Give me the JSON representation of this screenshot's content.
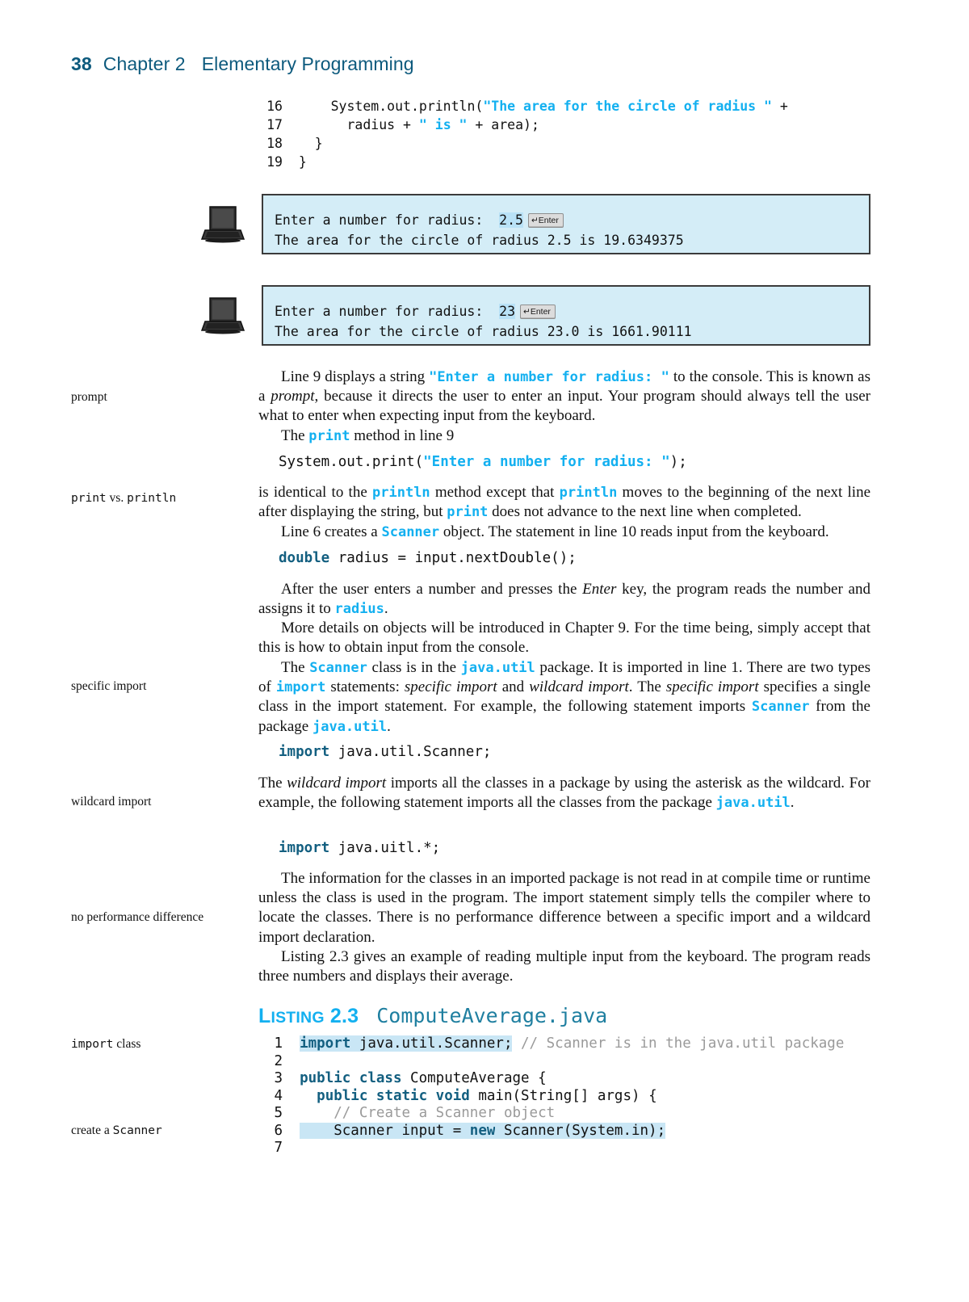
{
  "header": {
    "page_number": "38",
    "chapter": "Chapter 2",
    "title": "Elementary Programming",
    "accent_color": "#0d5a7d"
  },
  "top_code": {
    "lines": [
      {
        "num": "16",
        "segments": [
          {
            "text": "    System.out.println(",
            "style": "plain"
          },
          {
            "text": "\"The area for the circle of radius \"",
            "style": "string"
          },
          {
            "text": " +",
            "style": "plain"
          }
        ]
      },
      {
        "num": "17",
        "segments": [
          {
            "text": "      radius + ",
            "style": "plain"
          },
          {
            "text": "\" is \"",
            "style": "string"
          },
          {
            "text": " + area);",
            "style": "plain"
          }
        ]
      },
      {
        "num": "18",
        "segments": [
          {
            "text": "  }",
            "style": "plain"
          }
        ]
      },
      {
        "num": "19",
        "segments": [
          {
            "text": "}",
            "style": "plain"
          }
        ]
      }
    ]
  },
  "consoles": [
    {
      "icon": "laptop-icon",
      "prompt_label": "Enter a number for radius:  ",
      "input_value": "2.5",
      "enter_key_label": "Enter",
      "result_line": "The area for the circle of radius 2.5 is 19.6349375",
      "bg_color": "#d4edf7",
      "border_color": "#3b3b3b"
    },
    {
      "icon": "laptop-icon",
      "prompt_label": "Enter a number for radius:  ",
      "input_value": "23",
      "enter_key_label": "Enter",
      "result_line": "The area for the circle of radius 23.0 is 1661.90111",
      "bg_color": "#d4edf7",
      "border_color": "#3b3b3b"
    }
  ],
  "margin_notes": [
    {
      "id": "prompt",
      "text": "prompt"
    },
    {
      "id": "print-vs-println",
      "pre": "print",
      "mid": " vs. ",
      "post": "println"
    },
    {
      "id": "specific-import",
      "text": "specific import"
    },
    {
      "id": "wildcard-import",
      "text": "wildcard import"
    },
    {
      "id": "no-performance-difference",
      "text": "no performance difference"
    },
    {
      "id": "import-class",
      "pre": "import",
      "mid": " ",
      "post": "class"
    },
    {
      "id": "create-a-scanner",
      "pre": "create a ",
      "post": "Scanner"
    }
  ],
  "body": {
    "p1_a": "Line 9 displays a string ",
    "p1_code": "\"Enter a number for radius: \"",
    "p1_b": " to the console. This is known as a ",
    "p1_em": "prompt",
    "p1_c": ", because it directs the user to enter an input. Your program should always tell the user what to enter when expecting input from the keyboard.",
    "p2_a": "The ",
    "p2_code": "print",
    "p2_b": " method in line 9",
    "stmt1_plain_a": "System.out.print(",
    "stmt1_string": "\"Enter a number for radius: \"",
    "stmt1_plain_b": ");",
    "p3_a": "is identical to the ",
    "p3_c1": "println",
    "p3_b": " method except that ",
    "p3_c2": "println",
    "p3_c": " moves to the beginning of the next line after displaying the string, but ",
    "p3_c3": "print",
    "p3_d": " does not advance to the next line when completed.",
    "p4_a": "Line 6 creates a ",
    "p4_code": "Scanner",
    "p4_b": " object. The statement in line 10 reads input from the keyboard.",
    "stmt2_kw": "double",
    "stmt2_rest": " radius = input.nextDouble();",
    "p5_a": "After the user enters a number and presses the ",
    "p5_em": "Enter",
    "p5_b": " key, the program reads the number and assigns it to ",
    "p5_code": "radius",
    "p5_c": ".",
    "p6": "More details on objects will be introduced in Chapter 9. For the time being, simply accept that this is how to obtain input from the console.",
    "p7_a": "The ",
    "p7_c1": "Scanner",
    "p7_b": " class is in the ",
    "p7_c2": "java.util",
    "p7_c": " package. It is imported in line 1. There are two types of ",
    "p7_c3": "import",
    "p7_d": " statements: ",
    "p7_em1": "specific import",
    "p7_e": " and ",
    "p7_em2": "wildcard import",
    "p7_f": ". The ",
    "p7_em3": "specific import",
    "p7_g": " specifies a single class in the import statement. For example, the following statement imports ",
    "p7_c4": "Scanner",
    "p7_h": " from the package ",
    "p7_c5": "java.util",
    "p7_i": ".",
    "stmt3_kw": "import",
    "stmt3_rest": " java.util.Scanner;",
    "p8_a": "The ",
    "p8_em": "wildcard import",
    "p8_b": " imports all the classes in a package by using the asterisk as the wildcard. For example, the following statement imports all the classes from the package ",
    "p8_code": "java.util",
    "p8_c": ".",
    "stmt4_kw": "import",
    "stmt4_rest": " java.uitl.*;",
    "p9": "The information for the classes in an imported package is not read in at compile time or runtime unless the class is used in the program. The import statement simply tells the compiler where to locate the classes. There is no performance difference between a specific import and a wildcard import declaration.",
    "p10": "Listing 2.3 gives an example of reading multiple input from the keyboard. The program reads three numbers and displays their average."
  },
  "listing": {
    "label_l": "L",
    "label_isting": "ISTING",
    "label_num": "2.3",
    "filename": "ComputeAverage.java",
    "label_color": "#13b0f0",
    "filename_color": "#1f7fa0",
    "highlight_color": "#c9e6f5",
    "lines": [
      {
        "num": "1",
        "segments": [
          {
            "text": "import",
            "style": "keyword-dark",
            "highlight": true
          },
          {
            "text": " java.util.Scanner;",
            "style": "plain",
            "highlight": true
          },
          {
            "text": " // Scanner is in the java.util package",
            "style": "comment"
          }
        ]
      },
      {
        "num": "2",
        "segments": [
          {
            "text": "",
            "style": "plain"
          }
        ]
      },
      {
        "num": "3",
        "segments": [
          {
            "text": "public class",
            "style": "keyword-dark"
          },
          {
            "text": " ComputeAverage {",
            "style": "plain"
          }
        ]
      },
      {
        "num": "4",
        "segments": [
          {
            "text": "  ",
            "style": "plain"
          },
          {
            "text": "public static void",
            "style": "keyword-dark"
          },
          {
            "text": " main(String[] args) {",
            "style": "plain"
          }
        ]
      },
      {
        "num": "5",
        "segments": [
          {
            "text": "    ",
            "style": "plain"
          },
          {
            "text": "// Create a Scanner object",
            "style": "comment"
          }
        ]
      },
      {
        "num": "6",
        "segments": [
          {
            "text": "    Scanner input = ",
            "style": "plain",
            "highlight": true
          },
          {
            "text": "new",
            "style": "keyword-dark",
            "highlight": true
          },
          {
            "text": " Scanner(System.in);",
            "style": "plain",
            "highlight": true
          }
        ]
      },
      {
        "num": "7",
        "segments": [
          {
            "text": "",
            "style": "plain"
          }
        ]
      }
    ]
  }
}
